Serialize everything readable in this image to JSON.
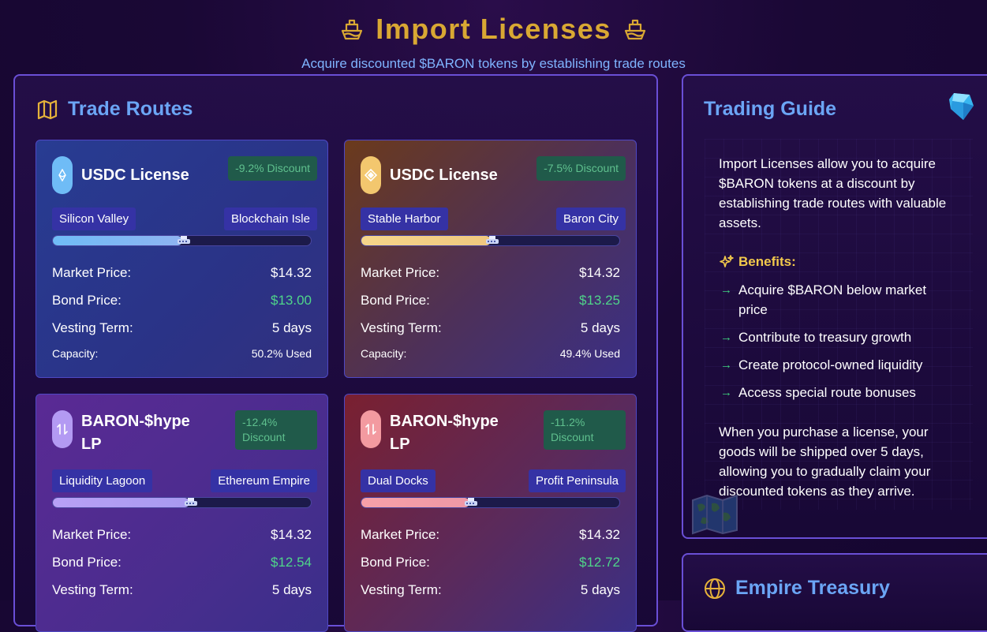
{
  "header": {
    "title": "Import Licenses",
    "subtitle": "Acquire discounted $BARON tokens by establishing trade routes"
  },
  "trade_routes": {
    "title": "Trade Routes",
    "cards": [
      {
        "name": "USDC License",
        "discount": "-9.2% Discount",
        "from": "Silicon Valley",
        "to": "Blockchain Isle",
        "progress": 0.5,
        "market_label": "Market Price:",
        "market_price": "$14.32",
        "bond_label": "Bond Price:",
        "bond_price": "$13.00",
        "vesting_label": "Vesting Term:",
        "vesting": "5 days",
        "capacity_label": "Capacity:",
        "capacity": "50.2% Used"
      },
      {
        "name": "USDC License",
        "discount": "-7.5% Discount",
        "from": "Stable Harbor",
        "to": "Baron City",
        "progress": 0.5,
        "market_label": "Market Price:",
        "market_price": "$14.32",
        "bond_label": "Bond Price:",
        "bond_price": "$13.25",
        "vesting_label": "Vesting Term:",
        "vesting": "5 days",
        "capacity_label": "Capacity:",
        "capacity": "49.4% Used"
      },
      {
        "name": "BARON-$hype LP",
        "discount": "-12.4% Discount",
        "from": "Liquidity Lagoon",
        "to": "Ethereum Empire",
        "progress": 0.53,
        "market_label": "Market Price:",
        "market_price": "$14.32",
        "bond_label": "Bond Price:",
        "bond_price": "$12.54",
        "vesting_label": "Vesting Term:",
        "vesting": "5 days"
      },
      {
        "name": "BARON-$hype LP",
        "discount": "-11.2% Discount",
        "from": "Dual Docks",
        "to": "Profit Peninsula",
        "progress": 0.42,
        "market_label": "Market Price:",
        "market_price": "$14.32",
        "bond_label": "Bond Price:",
        "bond_price": "$12.72",
        "vesting_label": "Vesting Term:",
        "vesting": "5 days"
      }
    ]
  },
  "guide": {
    "title": "Trading Guide",
    "intro": "Import Licenses allow you to acquire $BARON tokens at a discount by establishing trade routes with valuable assets.",
    "benefits_title": "Benefits:",
    "benefits": [
      "Acquire $BARON below market price",
      "Contribute to treasury growth",
      "Create protocol-owned liquidity",
      "Access special route bonuses"
    ],
    "outro": "When you purchase a license, your goods will be shipped over 5 days, allowing you to gradually claim your discounted tokens as they arrive."
  },
  "treasury": {
    "title": "Empire Treasury"
  },
  "colors": {
    "gold": "#d9a833",
    "blue_accent": "#6ba5f5",
    "green": "#4fd58a",
    "panel_border": "#6a4fd6"
  },
  "icons": {
    "title": "ship-icon",
    "trade_routes": "map-icon",
    "guide": "gem-icon",
    "benefits": "sparkles-icon",
    "treasury": "globe-icon",
    "usdc": "ethereum-icon",
    "usdc2": "diamond-icon",
    "lp": "swap-arrows-icon"
  }
}
